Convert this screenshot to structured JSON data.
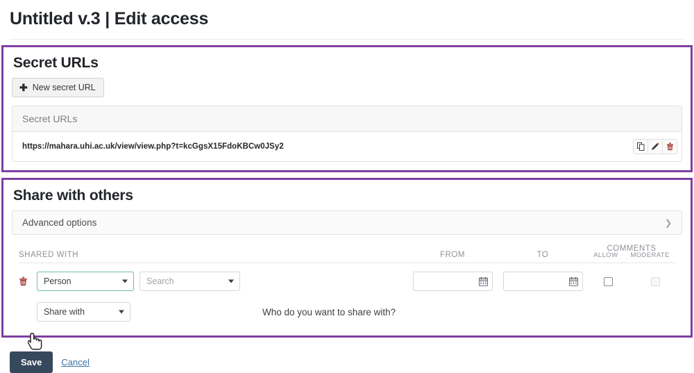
{
  "header": {
    "title": "Untitled v.3 | Edit access"
  },
  "secret_urls": {
    "panel_title": "Secret URLs",
    "new_button_label": "New secret URL",
    "new_button_icon": "plus-icon",
    "table_header": "Secret URLs",
    "rows": [
      {
        "url": "https://mahara.uhi.ac.uk/view/view.php?t=kcGgsX15FdoKBCw0JSy2",
        "actions": [
          "copy-icon",
          "edit-pencil-icon",
          "delete-trash-icon"
        ]
      }
    ]
  },
  "share": {
    "panel_title": "Share with others",
    "advanced_options_label": "Advanced options",
    "advanced_options_icon": "chevron-down-icon",
    "columns": {
      "shared_with": "Shared with",
      "from": "From",
      "to": "To",
      "comments": "Comments",
      "comments_allow": "Allow",
      "comments_moderate": "Moderate"
    },
    "rows": [
      {
        "delete_icon": "delete-trash-icon",
        "type_select_value": "Person",
        "search_select_value": "Search",
        "from_value": "",
        "to_value": "",
        "allow_checked": false,
        "moderate_checked": false,
        "moderate_disabled": true
      }
    ],
    "add_row": {
      "share_with_select_value": "Share with",
      "prompt": "Who do you want to share with?"
    }
  },
  "footer": {
    "save_label": "Save",
    "cancel_label": "Cancel"
  },
  "colors": {
    "panel_border": "#7e3fa3",
    "primary_button": "#36485c",
    "link": "#3d72a4",
    "focus_border": "#6fbf9a",
    "delete_icon": "#a33a33"
  }
}
